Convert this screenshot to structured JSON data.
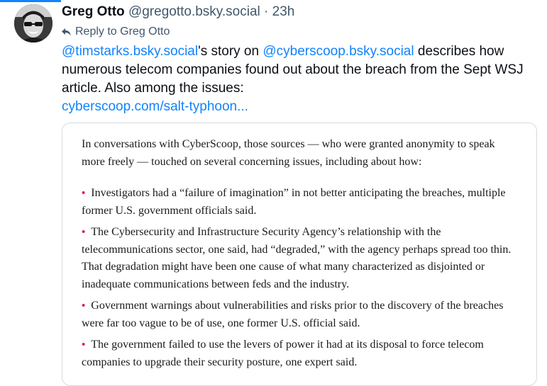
{
  "post": {
    "display_name": "Greg Otto",
    "handle": "@gregotto.bsky.social",
    "separator": "·",
    "time_ago": "23h",
    "reply_to_label": "Reply to Greg Otto",
    "text": {
      "mention1": "@timstarks.bsky.social",
      "part1": "'s story on ",
      "mention2": "@cyberscoop.bsky.social",
      "part2": " describes how numerous telecom companies found out about the breach from the Sept WSJ article. Also among the issues:",
      "link": "cyberscoop.com/salt-typhoon..."
    }
  },
  "embed": {
    "intro": "In conversations with CyberScoop, those sources — who were granted anonymity to speak more freely — touched on several concerning issues, including about how:",
    "bullet_char": "•",
    "bullets": [
      "Investigators had a “failure of imagination” in not better anticipating the breaches, multiple former U.S. government officials said.",
      "The Cybersecurity and Infrastructure Security Agency’s relationship with the telecommunications sector, one said, had “degraded,” with the agency perhaps spread too thin. That degradation might have been one cause of what many characterized as disjointed or inadequate communications between feds and the industry.",
      "Government warnings about vulnerabilities and risks prior to the discovery of the breaches were far too vague to be of use, one former U.S. official said.",
      "The government failed to use the levers of power it had at its disposal to force telecom companies to upgrade their security posture, one expert said."
    ]
  },
  "colors": {
    "link": "#1083fe",
    "muted": "#42576c",
    "bullet": "#e2185b",
    "border": "#d4dbe2"
  }
}
